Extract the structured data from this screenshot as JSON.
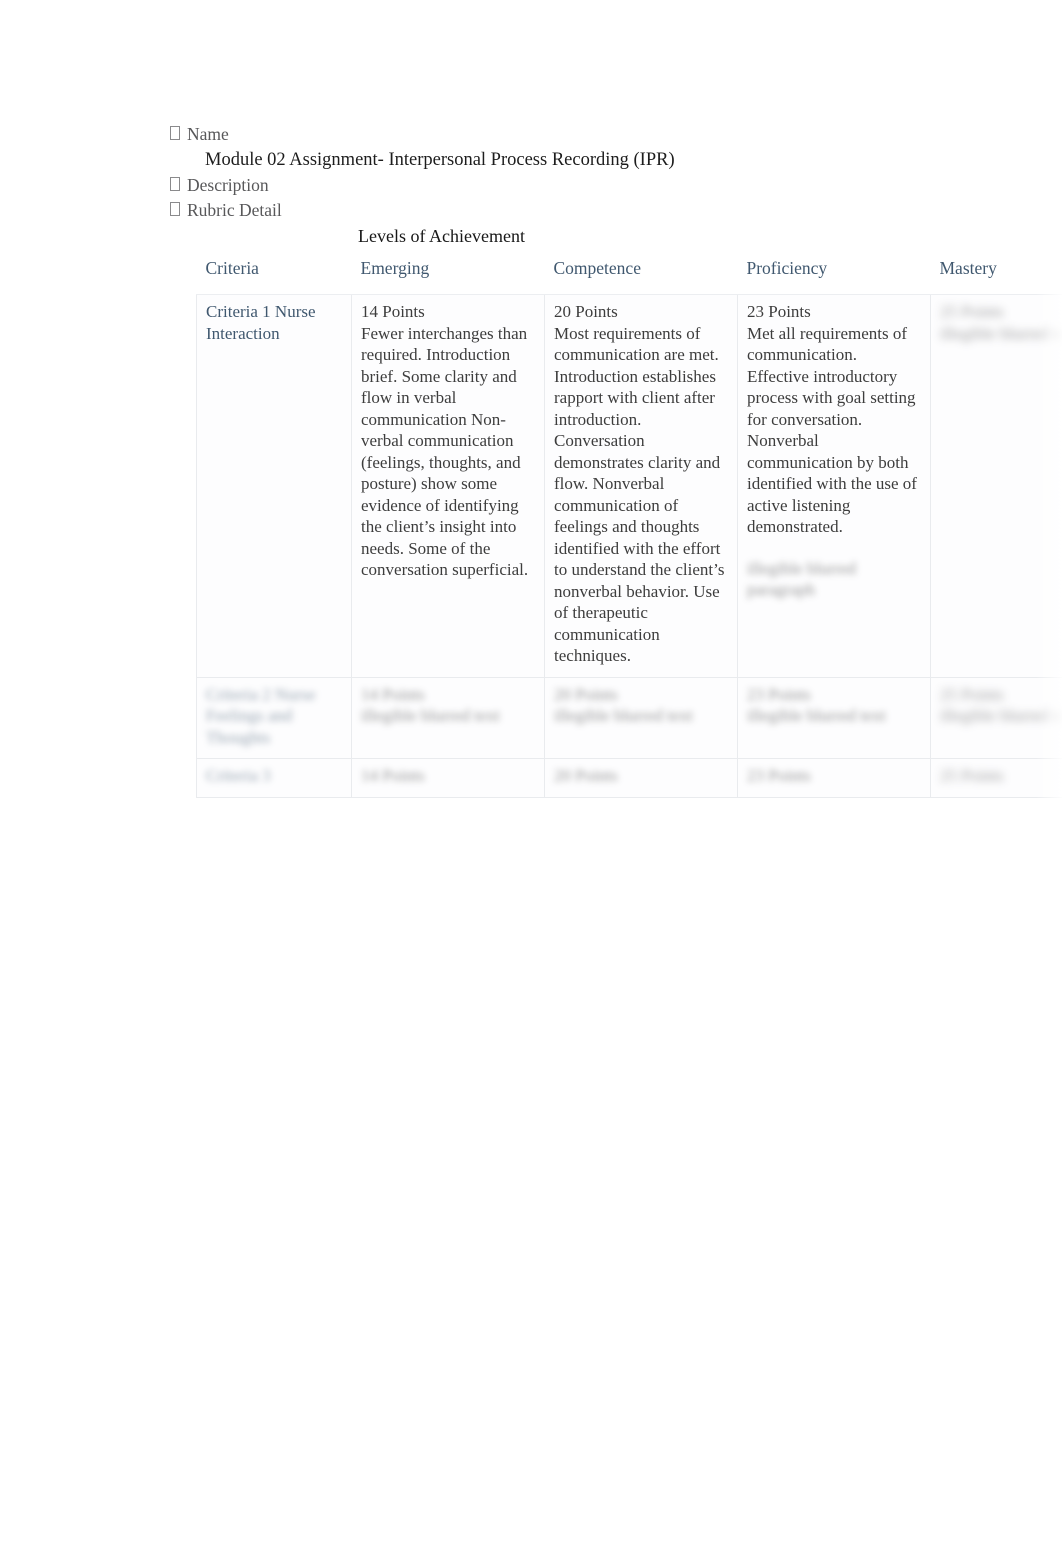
{
  "meta": {
    "bullet_glyph": "missing-glyph-box",
    "items": [
      {
        "label": "Name"
      },
      {
        "label": "Description"
      },
      {
        "label": "Rubric Detail"
      }
    ],
    "assignment_title": "Module 02 Assignment- Interpersonal Process Recording (IPR)"
  },
  "rubric": {
    "levels_header": "Levels of Achievement",
    "columns": [
      "Criteria",
      "Emerging",
      "Competence",
      "Proficiency",
      "Mastery"
    ],
    "rows": [
      {
        "criteria": "Criteria 1 Nurse Interaction",
        "criteria_blurred": false,
        "cells": [
          {
            "points": "14 Points",
            "text": "Fewer interchanges than required. Introduction brief. Some clarity and flow in verbal communication Non- verbal communication (feelings, thoughts, and posture) show some evidence of identifying the client’s insight into needs. Some of the conversation superficial.",
            "blur": "none"
          },
          {
            "points": "20 Points",
            "text": "Most requirements of communication are met. Introduction establishes rapport with client after introduction. Conversation demonstrates clarity and flow. Nonverbal communication of feelings and thoughts identified with the effort to understand the client’s nonverbal behavior. Use of therapeutic communication techniques.",
            "blur": "none"
          },
          {
            "points": "23 Points",
            "text": "Met all requirements of communication. Effective introductory process with goal setting for conversation. Nonverbal communication by both identified with the use of active listening demonstrated.",
            "blur": "none",
            "obscured_trailing_text": "illegible blurred paragraph",
            "trailing_blur": "lg"
          },
          {
            "points": "25 Points",
            "text": "illegible blurred text",
            "blur": "xl"
          }
        ]
      },
      {
        "criteria": "Criteria 2 Nurse Feelings and Thoughts",
        "criteria_blurred": true,
        "cells": [
          {
            "points": "14 Points",
            "text": "illegible blurred text",
            "blur": "lg"
          },
          {
            "points": "20 Points",
            "text": "illegible blurred text",
            "blur": "lg"
          },
          {
            "points": "23 Points",
            "text": "illegible blurred text",
            "blur": "lg"
          },
          {
            "points": "25 Points",
            "text": "illegible blurred text",
            "blur": "xl"
          }
        ]
      },
      {
        "criteria": "Criteria 3",
        "criteria_blurred": true,
        "cells": [
          {
            "points": "14 Points",
            "text": "",
            "blur": "lg"
          },
          {
            "points": "20 Points",
            "text": "",
            "blur": "lg"
          },
          {
            "points": "23 Points",
            "text": "",
            "blur": "lg"
          },
          {
            "points": "25 Points",
            "text": "",
            "blur": "xl"
          }
        ]
      }
    ]
  },
  "colors": {
    "heading_blue": "#40586f",
    "body_text": "#3d3d3d",
    "title_text": "#1d1d1d",
    "cell_border": "#e9ebee",
    "page_background": "#ffffff"
  }
}
